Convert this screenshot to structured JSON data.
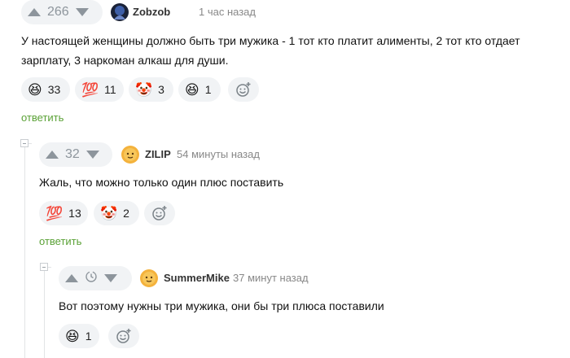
{
  "comments": [
    {
      "votes": "266",
      "author": "Zobzob",
      "time": "1 час назад",
      "text_line1": "У настоящей женщины должно быть три мужика - 1 тот кто платит алименты, 2 тот кто отдает",
      "text_line2": "зарплату, 3 наркоман алкаш для души.",
      "reactions": [
        {
          "icon": "laughing-emoji",
          "emoji": "😆",
          "count": "33"
        },
        {
          "icon": "hundred-emoji",
          "emoji": "💯",
          "count": "11"
        },
        {
          "icon": "clown-emoji",
          "emoji": "🤡",
          "count": "3"
        },
        {
          "icon": "laughing-emoji",
          "emoji": "😆",
          "count": "1"
        }
      ],
      "reply_label": "ответить"
    },
    {
      "votes": "32",
      "author": "ZILIP",
      "time": "54 минуты назад",
      "text": "Жаль, что можно только один плюс поставить",
      "reactions": [
        {
          "icon": "hundred-emoji",
          "emoji": "💯",
          "count": "13"
        },
        {
          "icon": "clown-emoji",
          "emoji": "🤡",
          "count": "2"
        }
      ],
      "reply_label": "ответить"
    },
    {
      "author": "SummerMike",
      "time": "37 минут назад",
      "text": "Вот поэтому нужны три мужика, они бы три плюса поставили",
      "reactions": [
        {
          "icon": "laughing-emoji",
          "emoji": "😆",
          "count": "1"
        }
      ]
    }
  ],
  "colors": {
    "reply_link": "#5aa136",
    "pill_bg": "#f1f3f5",
    "muted": "#8d959c"
  }
}
